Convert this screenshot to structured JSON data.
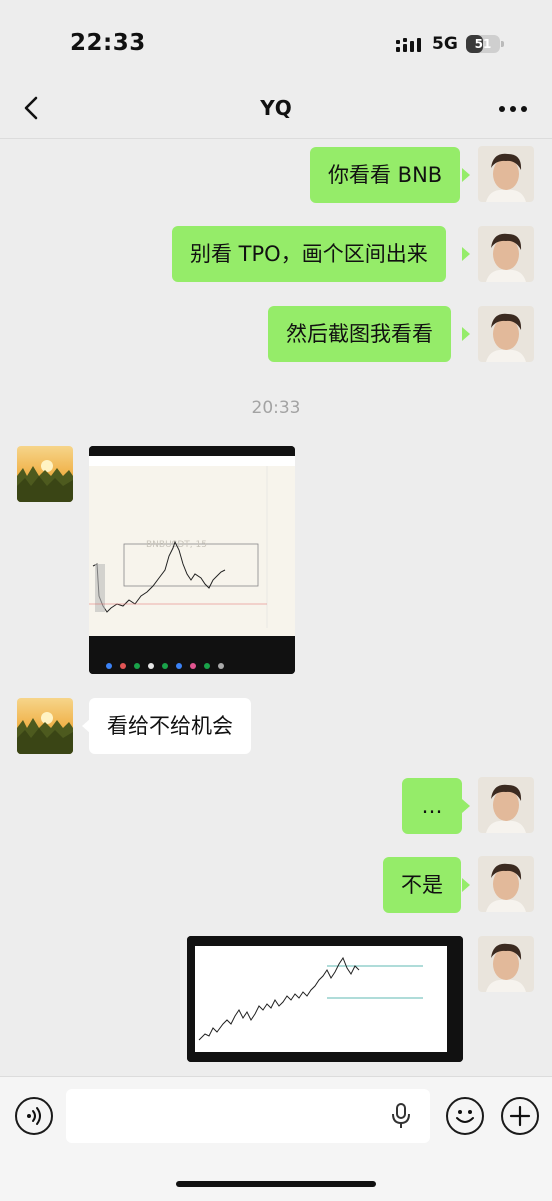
{
  "status_bar": {
    "time": "22:33",
    "network": "5G",
    "battery": "51",
    "battery_level_pct": 51
  },
  "header": {
    "title": "YQ"
  },
  "messages": {
    "m1": "你看看 BNB",
    "m2": "别看 TPO，画个区间出来",
    "m3": "然后截图我看看",
    "timestamp": "20:33",
    "m4_chart_watermark": "BNBUSDT, 15",
    "m5": "看给不给机会",
    "m6": "…",
    "m7": "不是"
  },
  "icons": {
    "back": "chevron-left-icon",
    "more": "more-dots-icon",
    "voice": "voice-icon",
    "mic": "mic-icon",
    "emoji": "emoji-icon",
    "add": "plus-icon"
  },
  "colors": {
    "outgoing_bubble": "#95ec69",
    "incoming_bubble": "#ffffff",
    "background": "#ededed"
  }
}
